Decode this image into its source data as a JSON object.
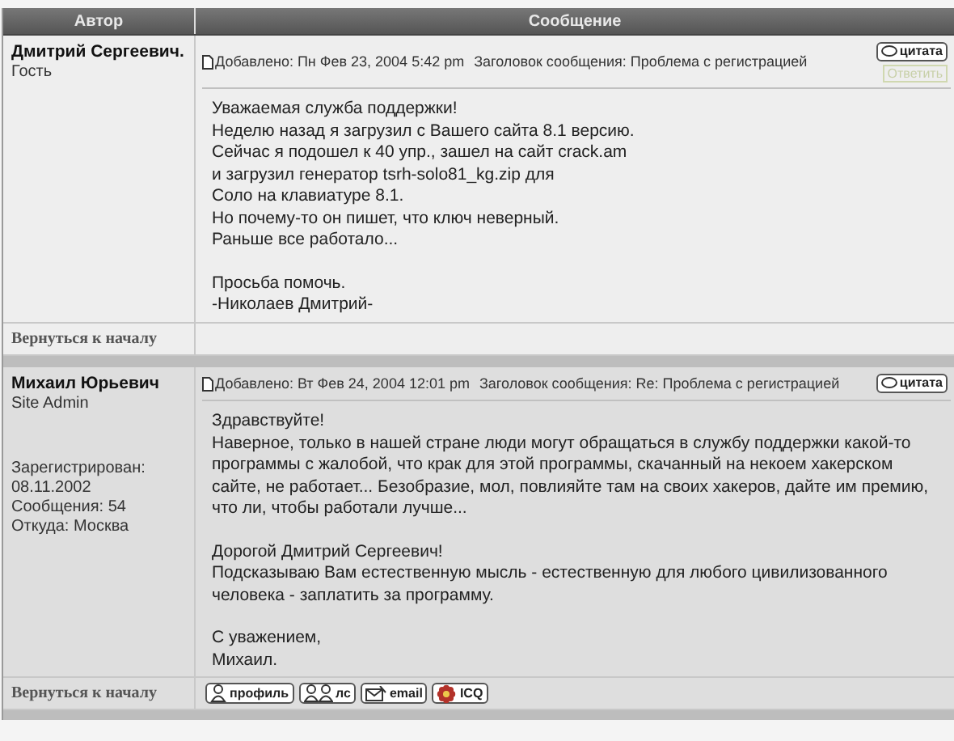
{
  "columns": [
    "Автор",
    "Сообщение"
  ],
  "posts": [
    {
      "author": "Дмитрий Сергеевич.",
      "rank": "Гость",
      "posted": "Добавлено: Пн Фев 23, 2004 5:42 pm",
      "subject": "Заголовок сообщения: Проблема с регистрацией",
      "quote_button": "цитата",
      "reply_button": "Ответить",
      "paragraphs": [
        [
          "Уважаемая служба поддержки!",
          "Неделю назад я загрузил с Вашего сайта 8.1 версию.",
          "Сейчас я подошел к 40 упр., зашел на сайт crack.am",
          "и загрузил генератор tsrh-solo81_kg.zip для",
          "Соло на клавиатуре 8.1.",
          "Но почему-то он пишет, что ключ неверный.",
          "Раньше все работало..."
        ],
        [
          "Просьба помочь.",
          "-Николаев Дмитрий-"
        ]
      ],
      "back_link": "Вернуться к началу"
    },
    {
      "author": "Михаил Юрьевич",
      "rank": "Site Admin",
      "profile": [
        "Зарегистрирован: 08.11.2002",
        "Сообщения: 54",
        "Откуда: Москва"
      ],
      "posted": "Добавлено: Вт Фев 24, 2004 12:01 pm",
      "subject": "Заголовок сообщения: Re: Проблема с регистрацией",
      "quote_button": "цитата",
      "paragraphs": [
        [
          "Здравствуйте!",
          "Наверное, только в нашей стране люди могут обращаться в службу поддержки какой-то программы с жалобой, что крак для этой программы, скачанный на некоем хакерском сайте, не работает... Безобразие, мол, повлияйте там на своих хакеров, дайте им премию, что ли, чтобы работали лучше..."
        ],
        [
          "Дорогой Дмитрий Сергеевич!",
          "Подсказываю Вам естественную мысль - естественную для любого цивилизованного человека - заплатить за программу."
        ],
        [
          "С уважением,",
          "Михаил."
        ]
      ],
      "back_link": "Вернуться к началу",
      "actions": [
        {
          "kind": "profile",
          "label": "профиль"
        },
        {
          "kind": "pm",
          "label": "лс"
        },
        {
          "kind": "email",
          "label": "email"
        },
        {
          "kind": "icq",
          "label": "ICQ"
        }
      ]
    }
  ]
}
